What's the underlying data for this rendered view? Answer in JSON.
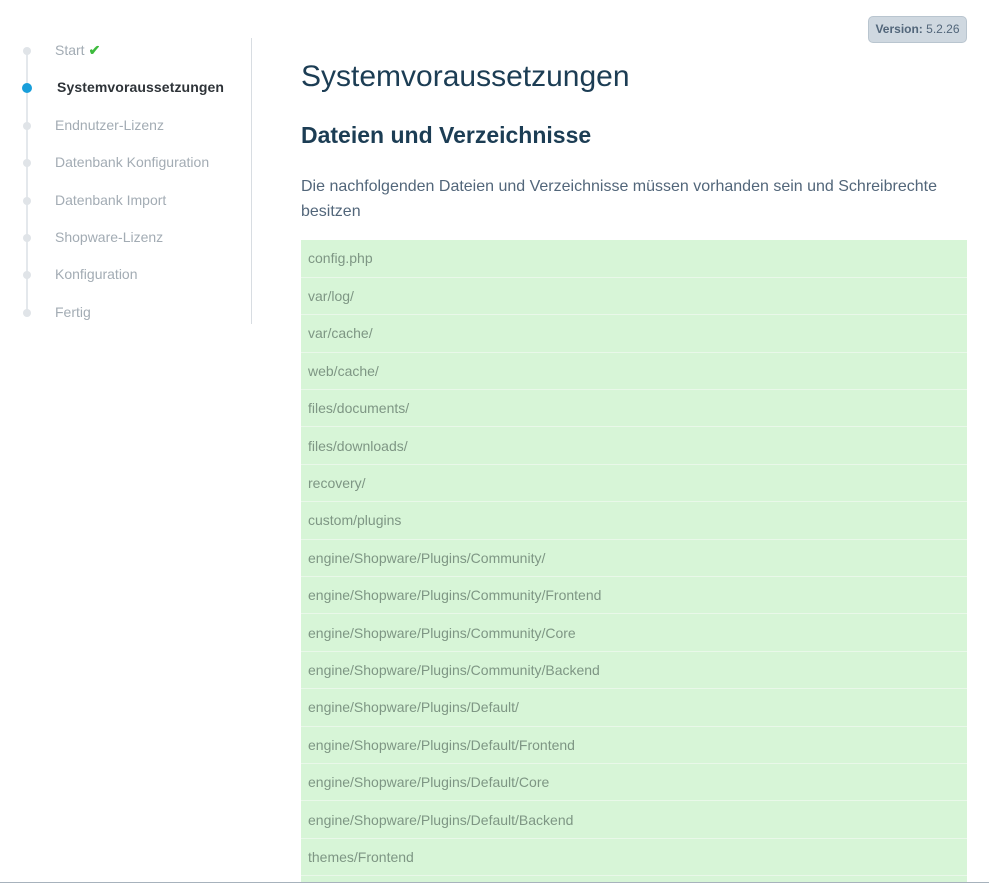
{
  "version": {
    "label": "Version:",
    "number": "5.2.26"
  },
  "sidebar": {
    "steps": [
      {
        "label": "Start",
        "state": "done",
        "icon": "check-icon"
      },
      {
        "label": "Systemvoraussetzungen",
        "state": "active"
      },
      {
        "label": "Endnutzer-Lizenz",
        "state": "pending"
      },
      {
        "label": "Datenbank Konfiguration",
        "state": "pending"
      },
      {
        "label": "Datenbank Import",
        "state": "pending"
      },
      {
        "label": "Shopware-Lizenz",
        "state": "pending"
      },
      {
        "label": "Konfiguration",
        "state": "pending"
      },
      {
        "label": "Fertig",
        "state": "pending"
      }
    ]
  },
  "main": {
    "title": "Systemvoraussetzungen",
    "section_title": "Dateien und Verzeichnisse",
    "description": "Die nachfolgenden Dateien und Verzeichnisse müssen vorhanden sein und Schreibrechte besitzen",
    "files": [
      "config.php",
      "var/log/",
      "var/cache/",
      "web/cache/",
      "files/documents/",
      "files/downloads/",
      "recovery/",
      "custom/plugins",
      "engine/Shopware/Plugins/Community/",
      "engine/Shopware/Plugins/Community/Frontend",
      "engine/Shopware/Plugins/Community/Core",
      "engine/Shopware/Plugins/Community/Backend",
      "engine/Shopware/Plugins/Default/",
      "engine/Shopware/Plugins/Default/Frontend",
      "engine/Shopware/Plugins/Default/Core",
      "engine/Shopware/Plugins/Default/Backend",
      "themes/Frontend",
      ""
    ]
  },
  "colors": {
    "accent": "#189eda",
    "success_row": "#d7f5d7",
    "check": "#3dbb3d",
    "heading": "#1c3d54"
  }
}
